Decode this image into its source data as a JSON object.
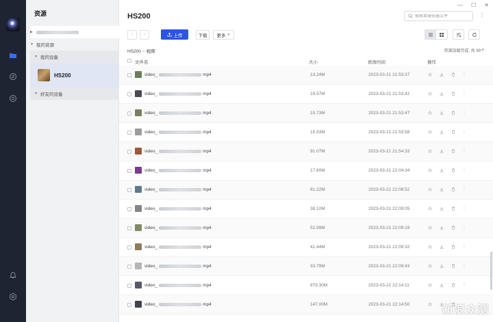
{
  "sidebar": {
    "title": "资源",
    "my_resources": "我的资源",
    "my_devices": "我的设备",
    "device_name": "HS200",
    "friend_devices": "好友的设备"
  },
  "header": {
    "title": "HS200",
    "search_placeholder": "搜索本服务器文件"
  },
  "toolbar": {
    "upload_label": "上传",
    "download_label": "下载",
    "more_label": "更多"
  },
  "breadcrumb": {
    "root": "HS200",
    "sep": ">",
    "current": "视频"
  },
  "status_text": "资源加载完成, 共 99个",
  "table": {
    "headers": {
      "name": "文件名",
      "size": "大小",
      "modified": "修改时间",
      "ops": "操作"
    },
    "rows": [
      {
        "prefix": "video_",
        "ext": "mp4",
        "size": "13.24M",
        "date": "2023-03-21 21:53:37",
        "thumb": "#6b7d5a"
      },
      {
        "prefix": "video_",
        "ext": "mp4",
        "size": "19.57M",
        "date": "2023-03-21 21:53:42",
        "thumb": "#4a4a55"
      },
      {
        "prefix": "video_",
        "ext": "mp4",
        "size": "15.73M",
        "date": "2023-03-21 21:53:47",
        "thumb": "#7a8063"
      },
      {
        "prefix": "video_",
        "ext": "mp4",
        "size": "15.93M",
        "date": "2023-03-21 21:53:58",
        "thumb": "#9c9c9c"
      },
      {
        "prefix": "video_",
        "ext": "mp4",
        "size": "91.07M",
        "date": "2023-03-21 21:54:33",
        "thumb": "#a0563b"
      },
      {
        "prefix": "video_",
        "ext": "mp4",
        "size": "17.60M",
        "date": "2023-03-21 22:04:34",
        "thumb": "#7b3a8e"
      },
      {
        "prefix": "video_",
        "ext": "mp4",
        "size": "61.22M",
        "date": "2023-03-21 22:08:52",
        "thumb": "#5f7a86"
      },
      {
        "prefix": "video_",
        "ext": "mp4",
        "size": "38.10M",
        "date": "2023-03-21 22:09:05",
        "thumb": "#86868a"
      },
      {
        "prefix": "video_",
        "ext": "mp4",
        "size": "52.99M",
        "date": "2023-03-21 22:09:19",
        "thumb": "#7d8c66"
      },
      {
        "prefix": "video_",
        "ext": "mp4",
        "size": "41.44M",
        "date": "2023-03-21 22:09:32",
        "thumb": "#8e7a5c"
      },
      {
        "prefix": "video_",
        "ext": "mp4",
        "size": "33.79M",
        "date": "2023-03-21 22:09:43",
        "thumb": "#b5b5b5"
      },
      {
        "prefix": "video_",
        "ext": "mp4",
        "size": "979.30M",
        "date": "2023-03-21 22:14:11",
        "thumb": "#555b66"
      },
      {
        "prefix": "video_",
        "ext": "mp4",
        "size": "147.00M",
        "date": "2023-03-21 22:14:50",
        "thumb": "#3f4450"
      }
    ]
  },
  "colors": {
    "accent": "#2c55e6",
    "rail_bg": "#1f2432",
    "selected_bg": "#e1e6f5"
  },
  "watermark": "新浪众测"
}
